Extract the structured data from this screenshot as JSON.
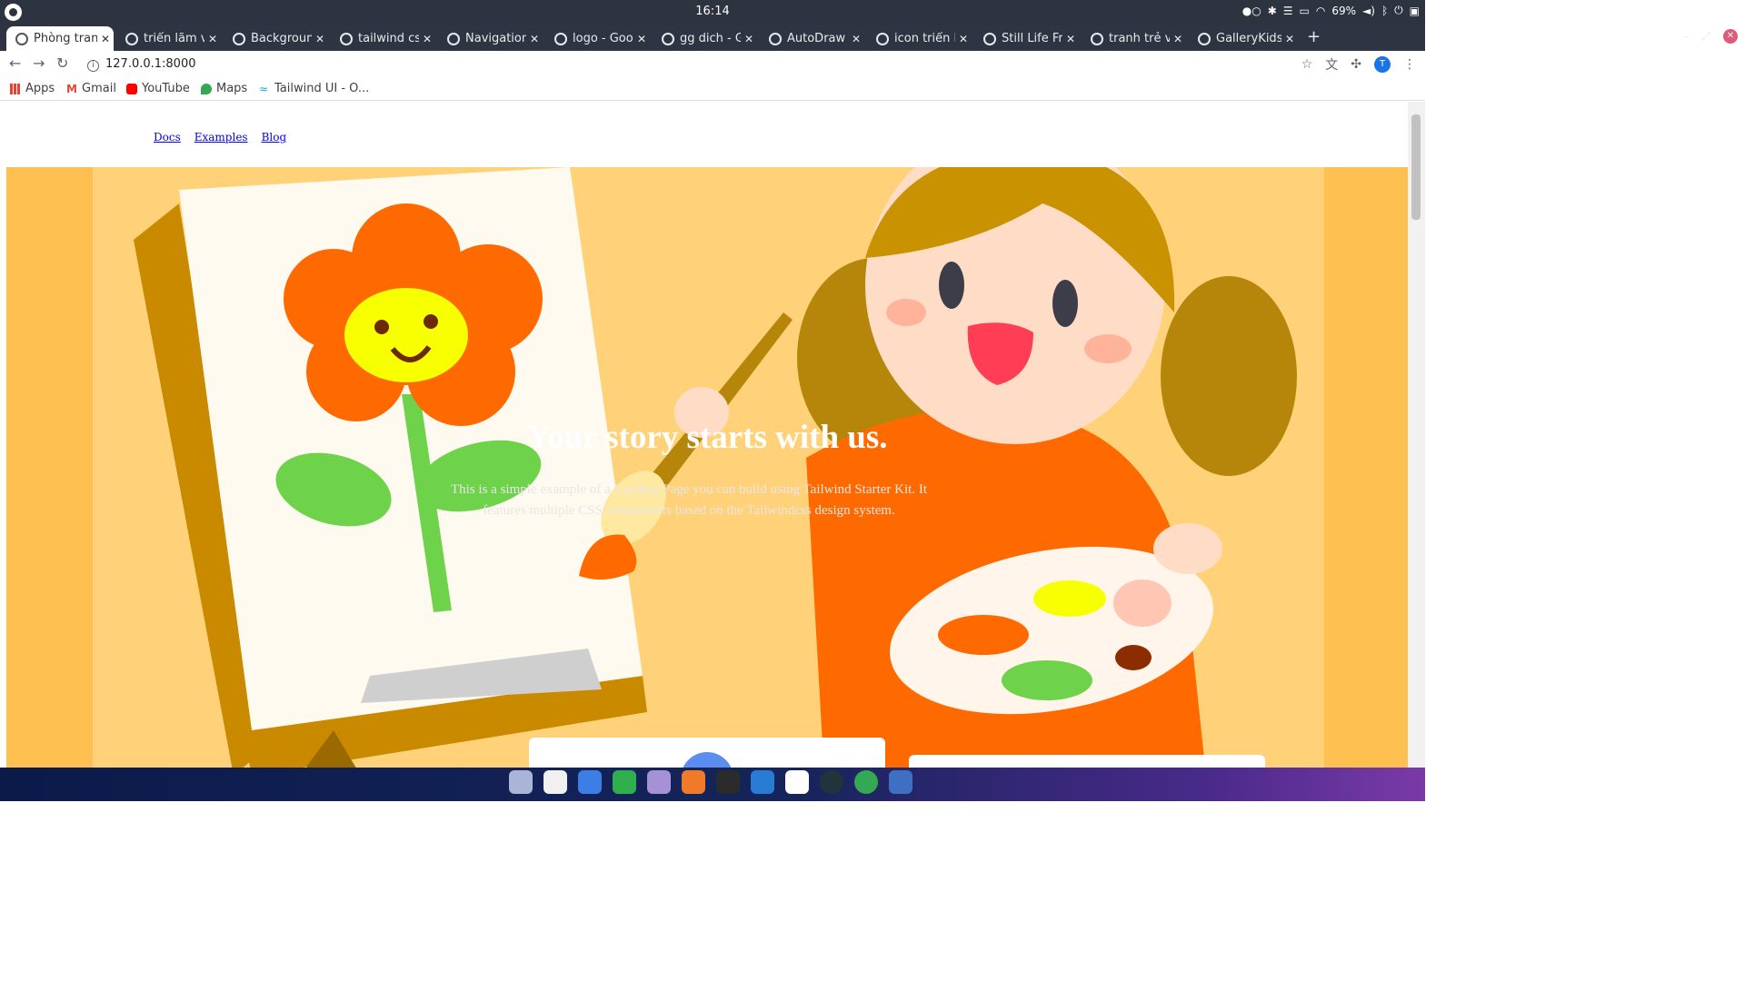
{
  "system": {
    "clock": "16:14",
    "battery": "69%"
  },
  "tabs": [
    {
      "title": "Phòng tranh",
      "active": true
    },
    {
      "title": "triển lãm vẽ"
    },
    {
      "title": "Background"
    },
    {
      "title": "tailwind css"
    },
    {
      "title": "Navigation"
    },
    {
      "title": "logo - Goog"
    },
    {
      "title": "gg dich - Gi"
    },
    {
      "title": "AutoDraw"
    },
    {
      "title": "icon triển lã"
    },
    {
      "title": "Still Life Fra"
    },
    {
      "title": "tranh trẻ vẽ"
    },
    {
      "title": "GalleryKids"
    }
  ],
  "address": {
    "url": "127.0.0.1:8000"
  },
  "profile": {
    "initial": "T"
  },
  "bookmarks": [
    {
      "label": "Apps"
    },
    {
      "label": "Gmail"
    },
    {
      "label": "YouTube"
    },
    {
      "label": "Maps"
    },
    {
      "label": "Tailwind UI - O..."
    }
  ],
  "site_nav": [
    "Docs",
    "Examples",
    "Blog"
  ],
  "hero": {
    "title": "Your story starts with us.",
    "text": "This is a simple example of a Landing Page you can build using Tailwind Starter Kit. It features multiple CSS components based on the Tailwindcss design system."
  },
  "colors": {
    "hero_bg": "#ffc052",
    "orange": "#ff6a00",
    "green": "#6ed34b",
    "accent_blue": "#5b8dee"
  }
}
